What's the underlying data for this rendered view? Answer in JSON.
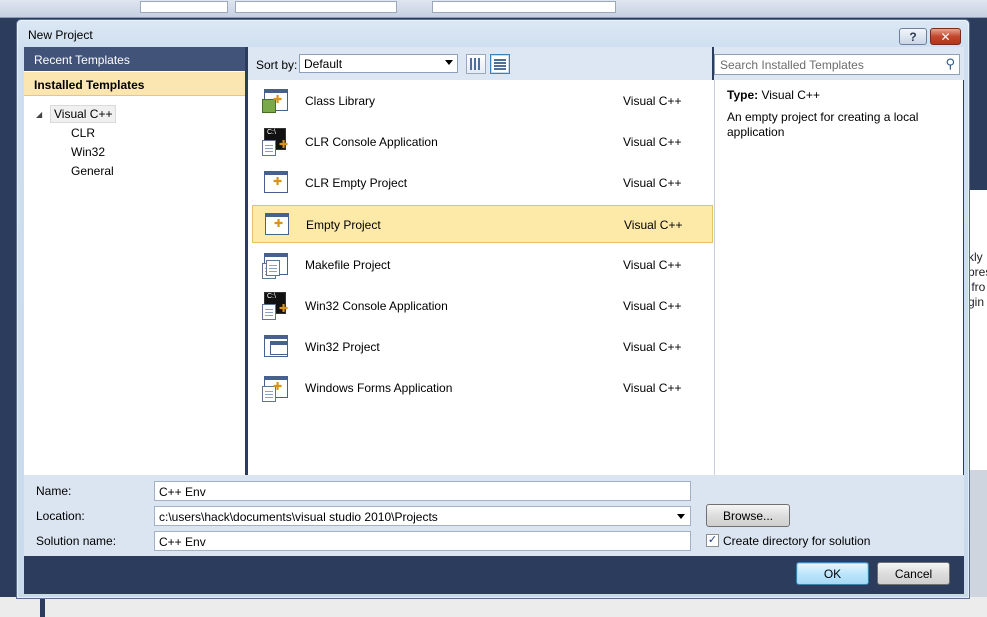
{
  "dialog": {
    "title": "New Project",
    "help_button": "?",
    "close_button": "✕"
  },
  "left_pane": {
    "recent_templates": "Recent Templates",
    "installed_templates": "Installed Templates",
    "tree": {
      "root": "Visual C++",
      "children": [
        "CLR",
        "Win32",
        "General"
      ]
    }
  },
  "sort": {
    "label": "Sort by:",
    "value": "Default"
  },
  "search": {
    "placeholder": "Search Installed Templates"
  },
  "templates": [
    {
      "name": "Class Library",
      "lang": "Visual C++",
      "icon": "class-library-icon"
    },
    {
      "name": "CLR Console Application",
      "lang": "Visual C++",
      "icon": "console-app-icon"
    },
    {
      "name": "CLR Empty Project",
      "lang": "Visual C++",
      "icon": "empty-project-icon"
    },
    {
      "name": "Empty Project",
      "lang": "Visual C++",
      "icon": "empty-project-icon",
      "selected": true
    },
    {
      "name": "Makefile Project",
      "lang": "Visual C++",
      "icon": "makefile-project-icon"
    },
    {
      "name": "Win32 Console Application",
      "lang": "Visual C++",
      "icon": "console-app-icon"
    },
    {
      "name": "Win32 Project",
      "lang": "Visual C++",
      "icon": "win32-project-icon"
    },
    {
      "name": "Windows Forms Application",
      "lang": "Visual C++",
      "icon": "windows-forms-icon"
    }
  ],
  "info": {
    "type_label": "Type:",
    "type_value": "Visual C++",
    "description": "An empty project for creating a local application"
  },
  "form": {
    "name_label": "Name:",
    "name_value": "C++ Env",
    "location_label": "Location:",
    "location_value": "c:\\users\\hack\\documents\\visual studio 2010\\Projects",
    "solution_label": "Solution name:",
    "solution_value": "C++ Env",
    "browse_button": "Browse...",
    "create_dir_label": "Create directory for solution",
    "create_dir_checked": true
  },
  "buttons": {
    "ok": "OK",
    "cancel": "Cancel"
  },
  "background": {
    "right_text": "kly\npres\n fro\ngin"
  }
}
